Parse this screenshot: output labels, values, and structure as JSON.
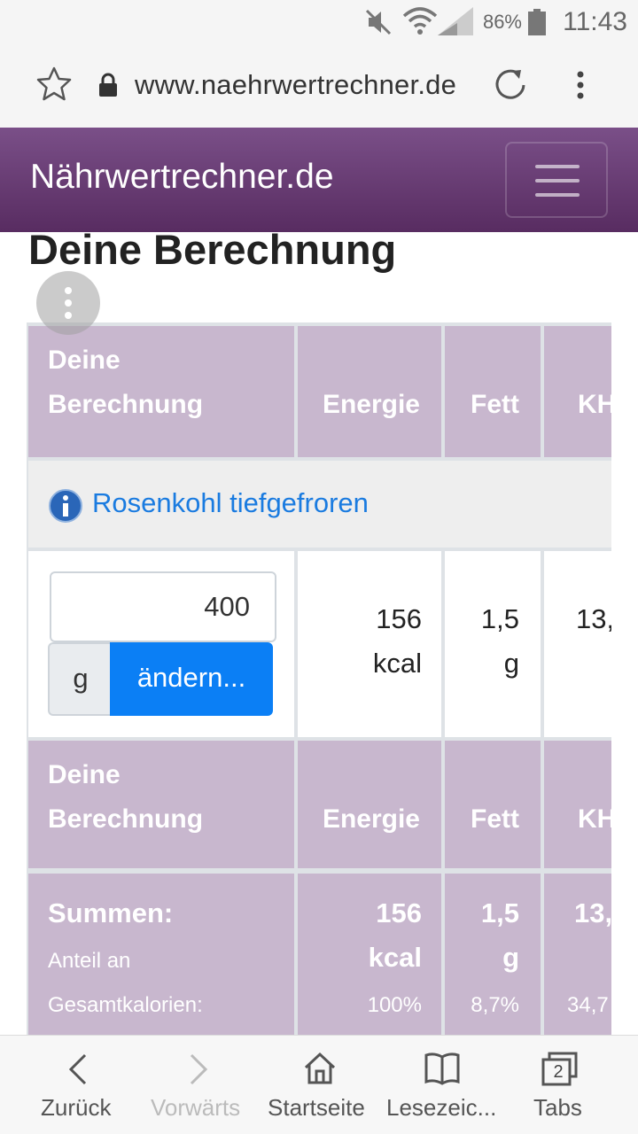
{
  "status_bar": {
    "battery": "86%",
    "time": "11:43"
  },
  "browser": {
    "url": "www.naehrwertrechner.de"
  },
  "site": {
    "brand": "Nährwertrechner.de"
  },
  "page": {
    "title": "Deine Berechnung"
  },
  "table": {
    "headers": [
      "Deine Berechnung",
      "Energie",
      "Fett",
      "KH"
    ],
    "food": {
      "name": "Rosenkohl tiefgefroren",
      "quantity": "400",
      "unit": "g",
      "change_label": "ändern...",
      "energy_value": "156",
      "energy_unit": "kcal",
      "fat_value": "1,5",
      "fat_unit": "g",
      "carb_value": "13,"
    },
    "footer_headers": [
      "Deine Berechnung",
      "Energie",
      "Fett",
      "KH"
    ],
    "sums": {
      "label": "Summen:",
      "share_label_1": "Anteil an",
      "share_label_2": "Gesamtkalorien:",
      "energy_value": "156",
      "energy_unit": "kcal",
      "fat_value": "1,5",
      "fat_unit": "g",
      "carb_value": "13,",
      "energy_share": "100%",
      "fat_share": "8,7%",
      "carb_share": "34,7"
    }
  },
  "bottom_nav": {
    "back": "Zurück",
    "forward": "Vorwärts",
    "home": "Startseite",
    "bookmarks": "Lesezeic...",
    "tabs": "Tabs",
    "tabs_count": "2"
  }
}
